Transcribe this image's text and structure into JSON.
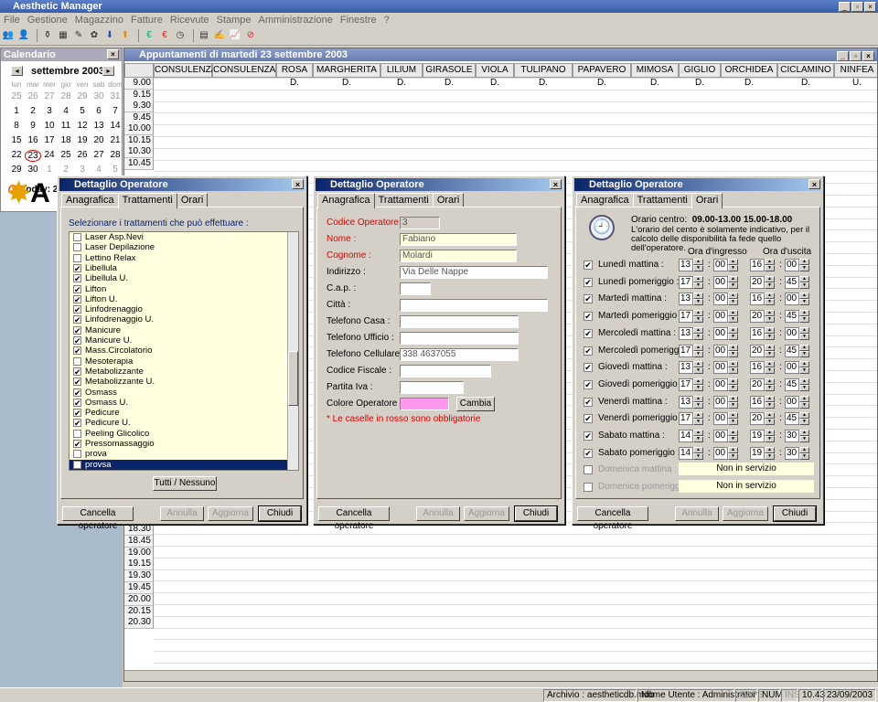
{
  "app": {
    "title": "Aesthetic Manager"
  },
  "menu": [
    "File",
    "Gestione",
    "Magazzino",
    "Fatture",
    "Ricevute",
    "Stampe",
    "Amministrazione",
    "Finestre",
    "?"
  ],
  "toolbar_icons": [
    "users-icon",
    "user-icon",
    "bottle-icon",
    "grid-icon",
    "edit-icon",
    "flower-icon",
    "arrow-down-icon",
    "arrow-up-icon",
    "euro-icon",
    "euro-red-icon",
    "clock-icon",
    "docs-icon",
    "docs-edit-icon",
    "chart-icon",
    "stop-icon"
  ],
  "calendar": {
    "title": "Calendario",
    "month": "settembre 2003",
    "weekdays": [
      "lun",
      "mar",
      "mer",
      "gio",
      "ven",
      "sab",
      "dom"
    ],
    "weeks": [
      [
        "25",
        "26",
        "27",
        "28",
        "29",
        "30",
        "31"
      ],
      [
        "1",
        "2",
        "3",
        "4",
        "5",
        "6",
        "7"
      ],
      [
        "8",
        "9",
        "10",
        "11",
        "12",
        "13",
        "14"
      ],
      [
        "15",
        "16",
        "17",
        "18",
        "19",
        "20",
        "21"
      ],
      [
        "22",
        "23",
        "24",
        "25",
        "26",
        "27",
        "28"
      ],
      [
        "29",
        "30",
        "1",
        "2",
        "3",
        "4",
        "5"
      ]
    ],
    "today_label": "Today: 23/09/2003"
  },
  "schedule": {
    "title": "Appuntamenti di martedi 23 settembre 2003",
    "columns": [
      "CONSULENZA",
      "CONSULENZA2",
      "ROSA D.",
      "MARGHERITA D.",
      "LILIUM D.",
      "GIRASOLE D.",
      "VIOLA D.",
      "TULIPANO D.",
      "PAPAVERO D.",
      "MIMOSA D.",
      "GIGLIO D.",
      "ORCHIDEA D.",
      "CICLAMINO D.",
      "NINFEA U."
    ],
    "times_top": [
      "9.00",
      "9.15",
      "9.30",
      "9.45",
      "10.00",
      "10.15",
      "10.30",
      "10.45"
    ],
    "times_bottom": [
      "18.30",
      "18.45",
      "19.00",
      "19.15",
      "19.30",
      "19.45",
      "20.00",
      "20.15",
      "20.30"
    ]
  },
  "dialog_title": "Dettaglio Operatore",
  "tabs": [
    "Anagrafica",
    "Trattamenti",
    "Orari"
  ],
  "treatments": {
    "instruction": "Selezionare i trattamenti che può effettuare :",
    "items": [
      {
        "label": "Laser Asp.Nevi",
        "checked": false
      },
      {
        "label": "Laser Depilazione",
        "checked": false
      },
      {
        "label": "Lettino Relax",
        "checked": false
      },
      {
        "label": "Libellula",
        "checked": true
      },
      {
        "label": "Libellula U.",
        "checked": true
      },
      {
        "label": "Lifton",
        "checked": true
      },
      {
        "label": "Lifton U.",
        "checked": true
      },
      {
        "label": "Linfodrenaggio",
        "checked": true
      },
      {
        "label": "Linfodrenaggio U.",
        "checked": true
      },
      {
        "label": "Manicure",
        "checked": true
      },
      {
        "label": "Manicure U.",
        "checked": true
      },
      {
        "label": "Mass.Circolatorio",
        "checked": true
      },
      {
        "label": "Mesoterapia",
        "checked": false
      },
      {
        "label": "Metabolizzante",
        "checked": true
      },
      {
        "label": "Metabolizzante U.",
        "checked": true
      },
      {
        "label": "Osmass",
        "checked": true
      },
      {
        "label": "Osmass U.",
        "checked": true
      },
      {
        "label": "Pedicure",
        "checked": true
      },
      {
        "label": "Pedicure U.",
        "checked": true
      },
      {
        "label": "Peeling Glicolico",
        "checked": false
      },
      {
        "label": "Pressomassaggio",
        "checked": true
      },
      {
        "label": "prova",
        "checked": false
      },
      {
        "label": "provsa",
        "checked": true
      }
    ],
    "all_none": "Tutti / Nessuno"
  },
  "buttons": {
    "cancella": "Cancella operatore",
    "annulla": "Annulla",
    "aggiorna": "Aggiorna",
    "chiudi": "Chiudi",
    "cambia": "Cambia"
  },
  "anagrafica": {
    "fields": [
      {
        "label": "Codice Operatore :",
        "value": "3",
        "required": true
      },
      {
        "label": "Nome :",
        "value": "Fabiano",
        "required": true
      },
      {
        "label": "Cognome :",
        "value": "Molardi",
        "required": true
      },
      {
        "label": "Indirizzo :",
        "value": "Via Delle Nappe",
        "required": false
      },
      {
        "label": "C.a.p. :",
        "value": "",
        "required": false
      },
      {
        "label": "Città :",
        "value": "",
        "required": false
      },
      {
        "label": "Telefono Casa :",
        "value": "",
        "required": false
      },
      {
        "label": "Telefono Ufficio :",
        "value": "",
        "required": false
      },
      {
        "label": "Telefono Cellulare :",
        "value": "338 4637055",
        "required": false
      },
      {
        "label": "Codice Fiscale :",
        "value": "",
        "required": false
      },
      {
        "label": "Partita Iva :",
        "value": "",
        "required": false
      },
      {
        "label": "Colore Operatore :",
        "value": "",
        "required": false
      }
    ],
    "color": "#ff99ee",
    "note": "* Le caselle in rosso sono obbligatorie"
  },
  "orari": {
    "centro_label": "Orario centro:",
    "centro_value": "09.00-13.00 15.00-18.00",
    "info": "L'orario del cento è solamente indicativo, per il calcolo delle disponibilità fa fede quello dell'operatore.",
    "col_in": "Ora d'ingresso",
    "col_out": "Ora d'uscita",
    "rows": [
      {
        "label": "Lunedì mattina :",
        "on": true,
        "in_h": "13",
        "in_m": "00",
        "out_h": "16",
        "out_m": "00"
      },
      {
        "label": "Lunedì pomeriggio :",
        "on": true,
        "in_h": "17",
        "in_m": "00",
        "out_h": "20",
        "out_m": "45"
      },
      {
        "label": "Martedì mattina :",
        "on": true,
        "in_h": "13",
        "in_m": "00",
        "out_h": "16",
        "out_m": "00"
      },
      {
        "label": "Martedì pomeriggio :",
        "on": true,
        "in_h": "17",
        "in_m": "00",
        "out_h": "20",
        "out_m": "45"
      },
      {
        "label": "Mercoledì mattina :",
        "on": true,
        "in_h": "13",
        "in_m": "00",
        "out_h": "16",
        "out_m": "00"
      },
      {
        "label": "Mercoledì pomeriggio :",
        "on": true,
        "in_h": "17",
        "in_m": "00",
        "out_h": "20",
        "out_m": "45"
      },
      {
        "label": "Giovedì mattina :",
        "on": true,
        "in_h": "13",
        "in_m": "00",
        "out_h": "16",
        "out_m": "00"
      },
      {
        "label": "Giovedì pomeriggio :",
        "on": true,
        "in_h": "17",
        "in_m": "00",
        "out_h": "20",
        "out_m": "45"
      },
      {
        "label": "Venerdì mattina :",
        "on": true,
        "in_h": "13",
        "in_m": "00",
        "out_h": "16",
        "out_m": "00"
      },
      {
        "label": "Venerdì pomeriggio :",
        "on": true,
        "in_h": "17",
        "in_m": "00",
        "out_h": "20",
        "out_m": "45"
      },
      {
        "label": "Sabato mattina :",
        "on": true,
        "in_h": "14",
        "in_m": "00",
        "out_h": "19",
        "out_m": "30"
      },
      {
        "label": "Sabato pomeriggio :",
        "on": true,
        "in_h": "14",
        "in_m": "00",
        "out_h": "19",
        "out_m": "30"
      }
    ],
    "off_rows": [
      {
        "label": "Domenica mattina :",
        "value": "Non in servizio"
      },
      {
        "label": "Domenica pomeriggio :",
        "value": "Non in servizio"
      }
    ]
  },
  "status": {
    "archivio": "Archivio : aestheticdb.mdb",
    "utente": "Nome Utente : Administrator",
    "caps": "CAPS",
    "num": "NUM",
    "ins": "INS",
    "time": "10.43",
    "date": "23/09/2003"
  }
}
